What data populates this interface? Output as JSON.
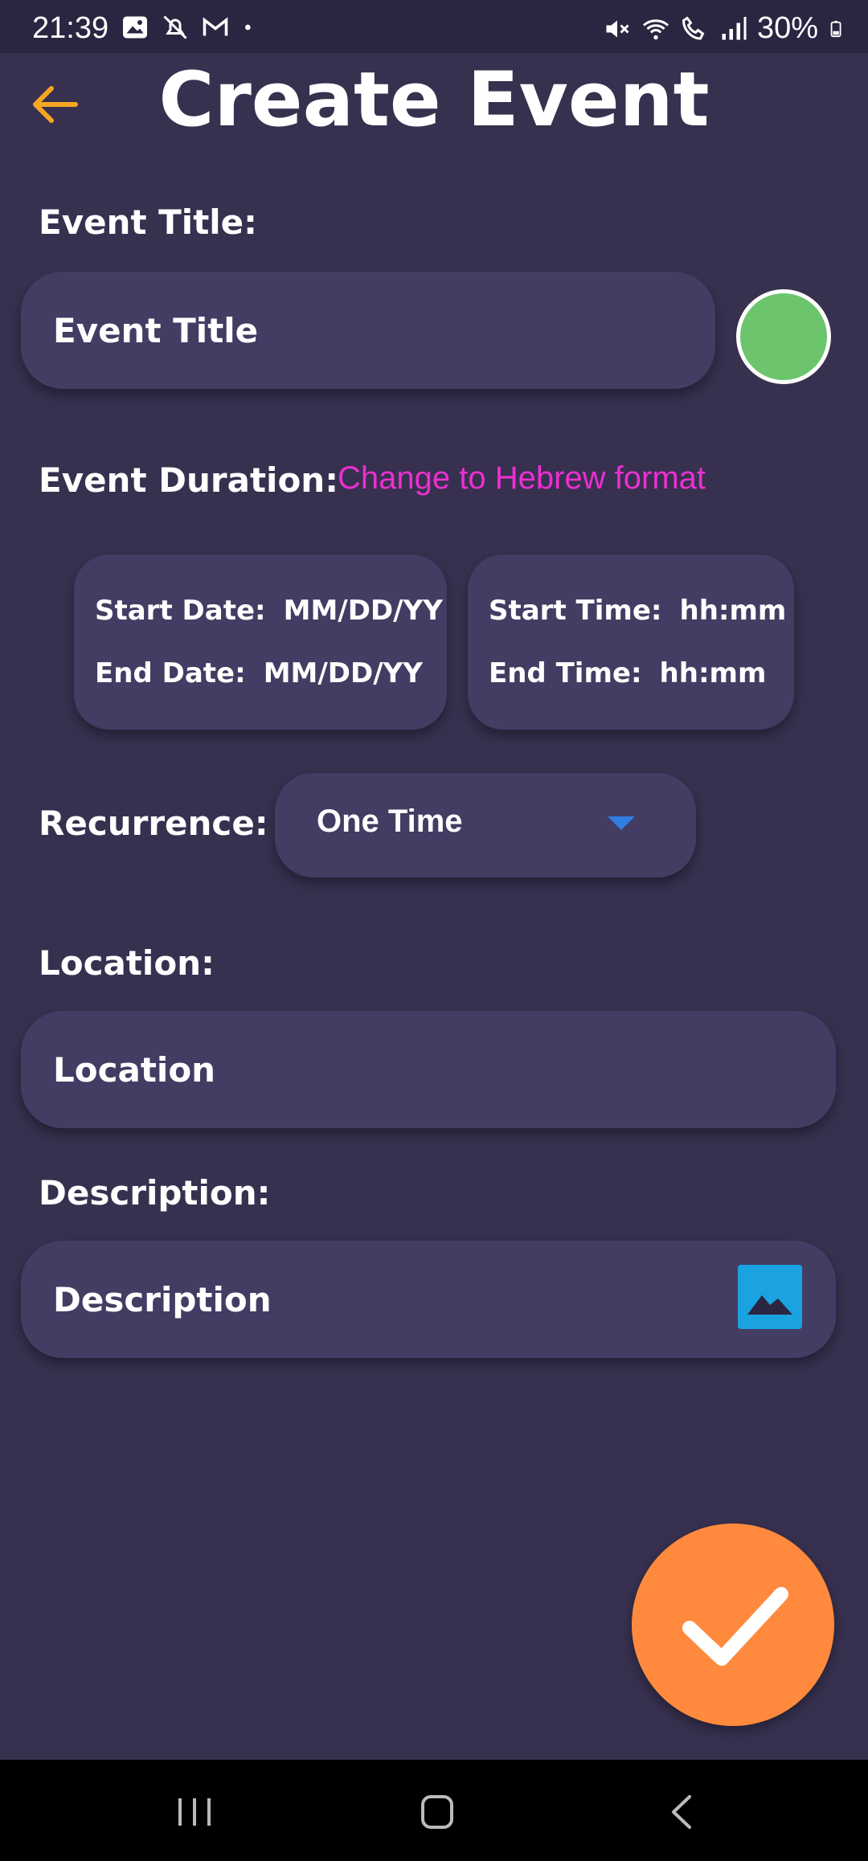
{
  "status_bar": {
    "time": "21:39",
    "battery": "30%",
    "left_icons": [
      "gallery-icon",
      "notifications-off-icon",
      "gmail-icon",
      "dot-icon"
    ],
    "right_icons": [
      "mute-icon",
      "wifi-icon",
      "wifi-calling-icon",
      "signal-icon",
      "battery-icon"
    ]
  },
  "header": {
    "title": "Create Event"
  },
  "event_title": {
    "label": "Event Title:",
    "placeholder": "Event Title",
    "color": "#6cc56c"
  },
  "duration": {
    "label": "Event Duration:",
    "hebrew_link": "Change to Hebrew format",
    "start_date_label": "Start Date:",
    "start_date_value": "MM/DD/YY",
    "end_date_label": "End Date:",
    "end_date_value": "MM/DD/YY",
    "start_time_label": "Start Time:",
    "start_time_value": "hh:mm",
    "end_time_label": "End Time:",
    "end_time_value": "hh:mm"
  },
  "recurrence": {
    "label": "Recurrence:",
    "selected": "One Time"
  },
  "location": {
    "label": "Location:",
    "placeholder": "Location"
  },
  "description": {
    "label": "Description:",
    "placeholder": "Description"
  },
  "colors": {
    "background": "#37304f",
    "field": "#433c63",
    "accent_orange": "#ff8a3d",
    "back_arrow": "#f5a623",
    "link": "#ec2fd1",
    "image_icon": "#1aa3e0"
  },
  "nav_bar": {
    "icons": [
      "recents-icon",
      "home-icon",
      "back-icon"
    ]
  }
}
